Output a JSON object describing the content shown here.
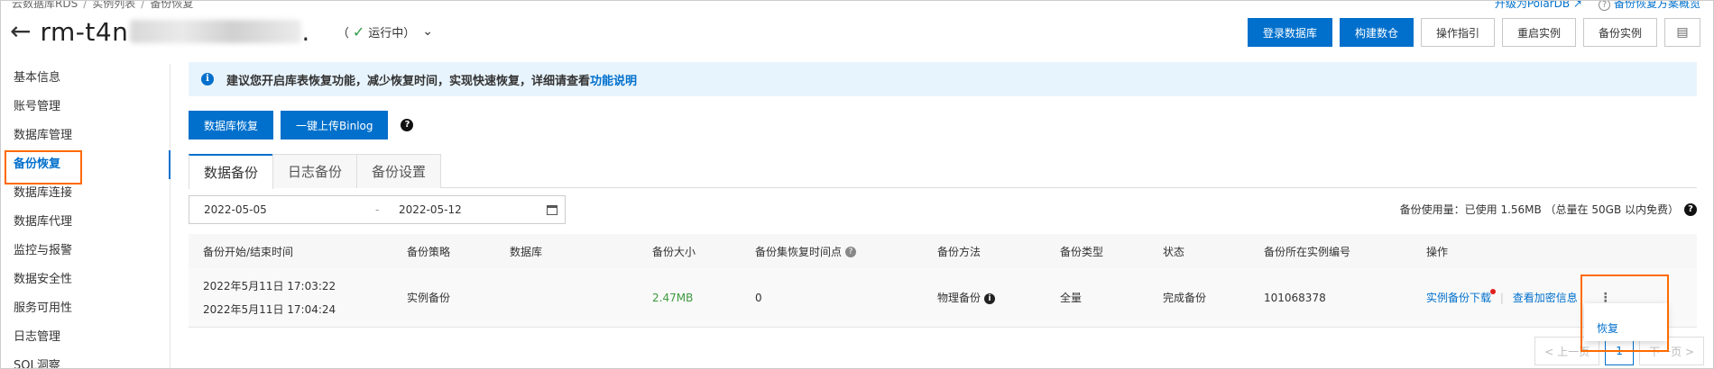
{
  "breadcrumb": [
    "云数据库RDS",
    "实例列表",
    "备份恢复"
  ],
  "header": {
    "instance_id_visible": "rm-t4n",
    "instance_id_tail": ".",
    "status": "运行中",
    "top_link_upgrade": "升级为PolarDB",
    "top_link_help": "备份恢复方案概览"
  },
  "actions": {
    "login": "登录数据库",
    "build_warehouse": "构建数仓",
    "guide": "操作指引",
    "restart": "重启实例",
    "backup": "备份实例"
  },
  "sidebar": {
    "items": [
      {
        "label": "基本信息"
      },
      {
        "label": "账号管理"
      },
      {
        "label": "数据库管理"
      },
      {
        "label": "备份恢复"
      },
      {
        "label": "数据库连接"
      },
      {
        "label": "数据库代理"
      },
      {
        "label": "监控与报警"
      },
      {
        "label": "数据安全性"
      },
      {
        "label": "服务可用性"
      },
      {
        "label": "日志管理"
      },
      {
        "label": "SQL洞察"
      }
    ]
  },
  "notice": {
    "text": "建议您开启库表恢复功能，减少恢复时间，实现快速恢复，详细请查看",
    "link": "功能说明"
  },
  "buttons": {
    "db_restore": "数据库恢复",
    "upload_binlog": "一键上传Binlog"
  },
  "tabs": [
    "数据备份",
    "日志备份",
    "备份设置"
  ],
  "date_range": {
    "start": "2022-05-05",
    "sep": "-",
    "end": "2022-05-12"
  },
  "usage": "备份使用量：已使用 1.56MB （总量在 50GB 以内免费）",
  "table": {
    "headers": [
      "备份开始/结束时间",
      "备份策略",
      "数据库",
      "备份大小",
      "备份集恢复时间点",
      "备份方法",
      "备份类型",
      "状态",
      "备份所在实例编号",
      "操作"
    ],
    "rows": [
      {
        "start": "2022年5月11日 17:03:22",
        "end": "2022年5月11日 17:04:24",
        "policy": "实例备份",
        "database": "",
        "size": "2.47MB",
        "restore_point": "0",
        "method": "物理备份",
        "type": "全量",
        "status": "完成备份",
        "instance_no": "101068378",
        "op_download": "实例备份下载",
        "op_view": "查看加密信息"
      }
    ]
  },
  "popup": {
    "restore": "恢复"
  },
  "pager": {
    "prev": "< 上一页",
    "page": "1",
    "next": "下一页 >"
  },
  "colors": {
    "accent": "#0070cc",
    "highlight": "#ff6a00",
    "success": "#2e9a45"
  }
}
